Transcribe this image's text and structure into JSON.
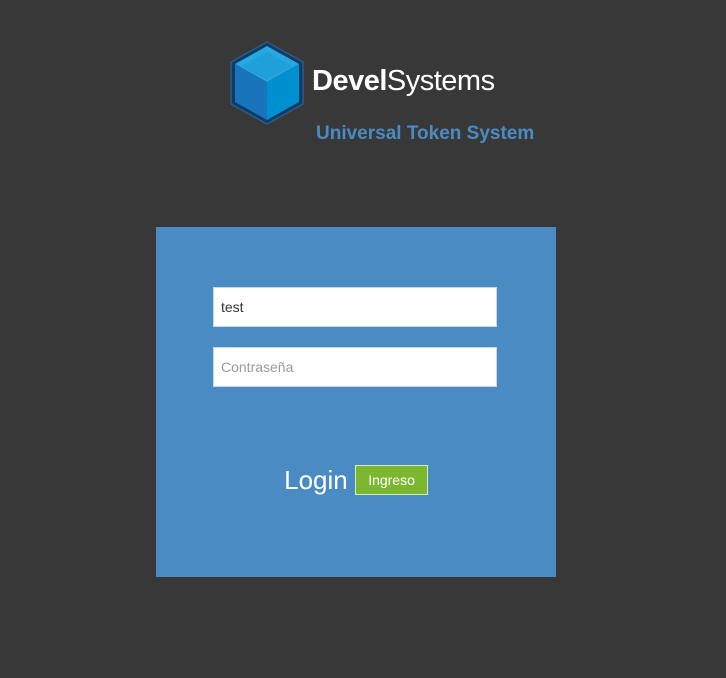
{
  "brand": {
    "name_bold": "Devel",
    "name_light": "Systems",
    "subtitle": "Universal Token System",
    "logo_icon": "cube-icon",
    "colors": {
      "background": "#383838",
      "accent": "#4a8bc4",
      "button": "#7cb82f",
      "cube_top": "#26a9e0",
      "cube_left": "#1a74bb",
      "cube_right": "#0090d0"
    }
  },
  "login_form": {
    "username": {
      "value": "test",
      "placeholder": ""
    },
    "password": {
      "value": "",
      "placeholder": "Contraseña"
    },
    "login_label": "Login",
    "submit_label": "Ingreso"
  }
}
